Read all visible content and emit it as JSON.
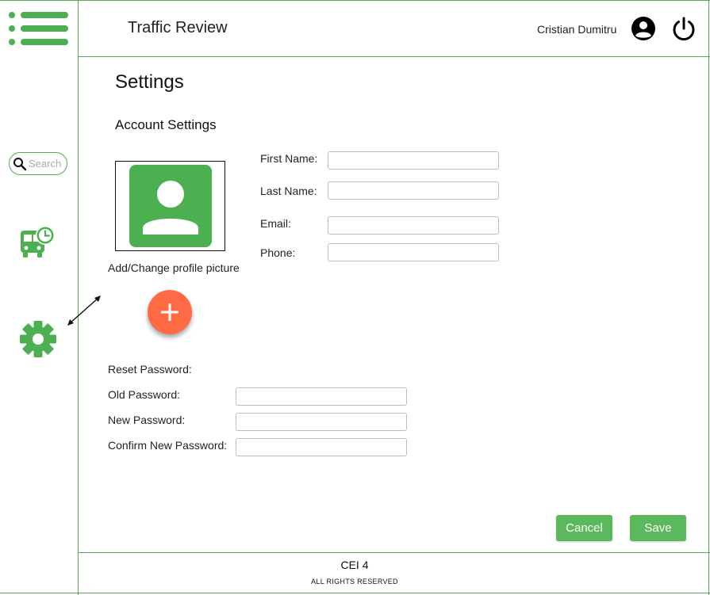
{
  "header": {
    "title": "Traffic Review",
    "user_name": "Cristian Dumitru",
    "menu_icon": "hamburger-menu-icon",
    "account_icon": "account-circle-icon",
    "power_icon": "power-icon"
  },
  "sidebar": {
    "search_placeholder": "Search",
    "items": [
      {
        "icon": "bus-schedule-icon"
      },
      {
        "icon": "gear-icon"
      }
    ]
  },
  "page": {
    "title": "Settings",
    "section_title": "Account Settings",
    "profile_picture_label": "Add/Change profile picture",
    "fields": {
      "first_name_label": "First Name:",
      "last_name_label": "Last Name:",
      "email_label": "Email:",
      "phone_label": "Phone:"
    },
    "password": {
      "heading": "Reset Password:",
      "old_label": "Old Password:",
      "new_label": "New Password:",
      "confirm_label": "Confirm New Password:"
    },
    "buttons": {
      "cancel": "Cancel",
      "save": "Save"
    }
  },
  "footer": {
    "title": "CEI 4",
    "rights": "ALL RIGHTS RESERVED"
  },
  "colors": {
    "accent_green": "#4caf50",
    "button_green": "#5cb85c",
    "frame_green": "#5aa55a",
    "fab_orange": "#ff6a45"
  }
}
